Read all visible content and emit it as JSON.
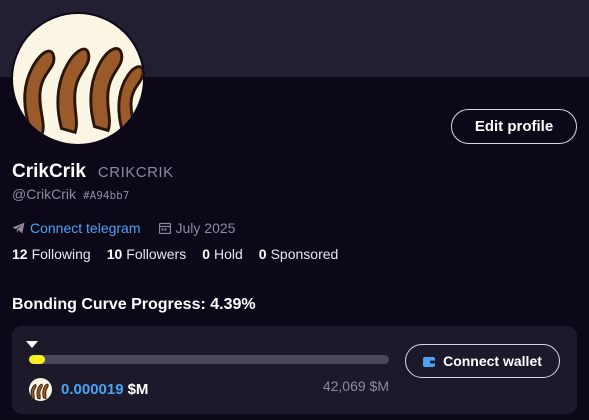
{
  "profile": {
    "display_name": "CrikCrik",
    "ticker": "CRIKCRIK",
    "handle": "@CrikCrik",
    "hash_id": "#A94bb7",
    "edit_label": "Edit profile",
    "avatar_icon": "brown-sticks-avatar"
  },
  "meta": {
    "telegram_label": "Connect telegram",
    "telegram_icon": "telegram-icon",
    "joined": "July 2025",
    "calendar_icon": "calendar-icon"
  },
  "stats": [
    {
      "value": "12",
      "label": "Following"
    },
    {
      "value": "10",
      "label": "Followers"
    },
    {
      "value": "0",
      "label": "Hold"
    },
    {
      "value": "0",
      "label": "Sponsored"
    }
  ],
  "bonding_curve": {
    "title": "Bonding Curve Progress: 4.39%",
    "progress_percent": 4.39,
    "price": "0.000019",
    "price_unit": "$M",
    "market_cap": "42,069 $M",
    "wallet_label": "Connect wallet",
    "wallet_icon": "wallet-icon",
    "bar_color": "#f5f01e",
    "price_color": "#4aa3f5"
  },
  "colors": {
    "background": "#0c0818",
    "banner": "#221f32",
    "card": "#1c1a2a",
    "link": "#4aa3f5"
  }
}
